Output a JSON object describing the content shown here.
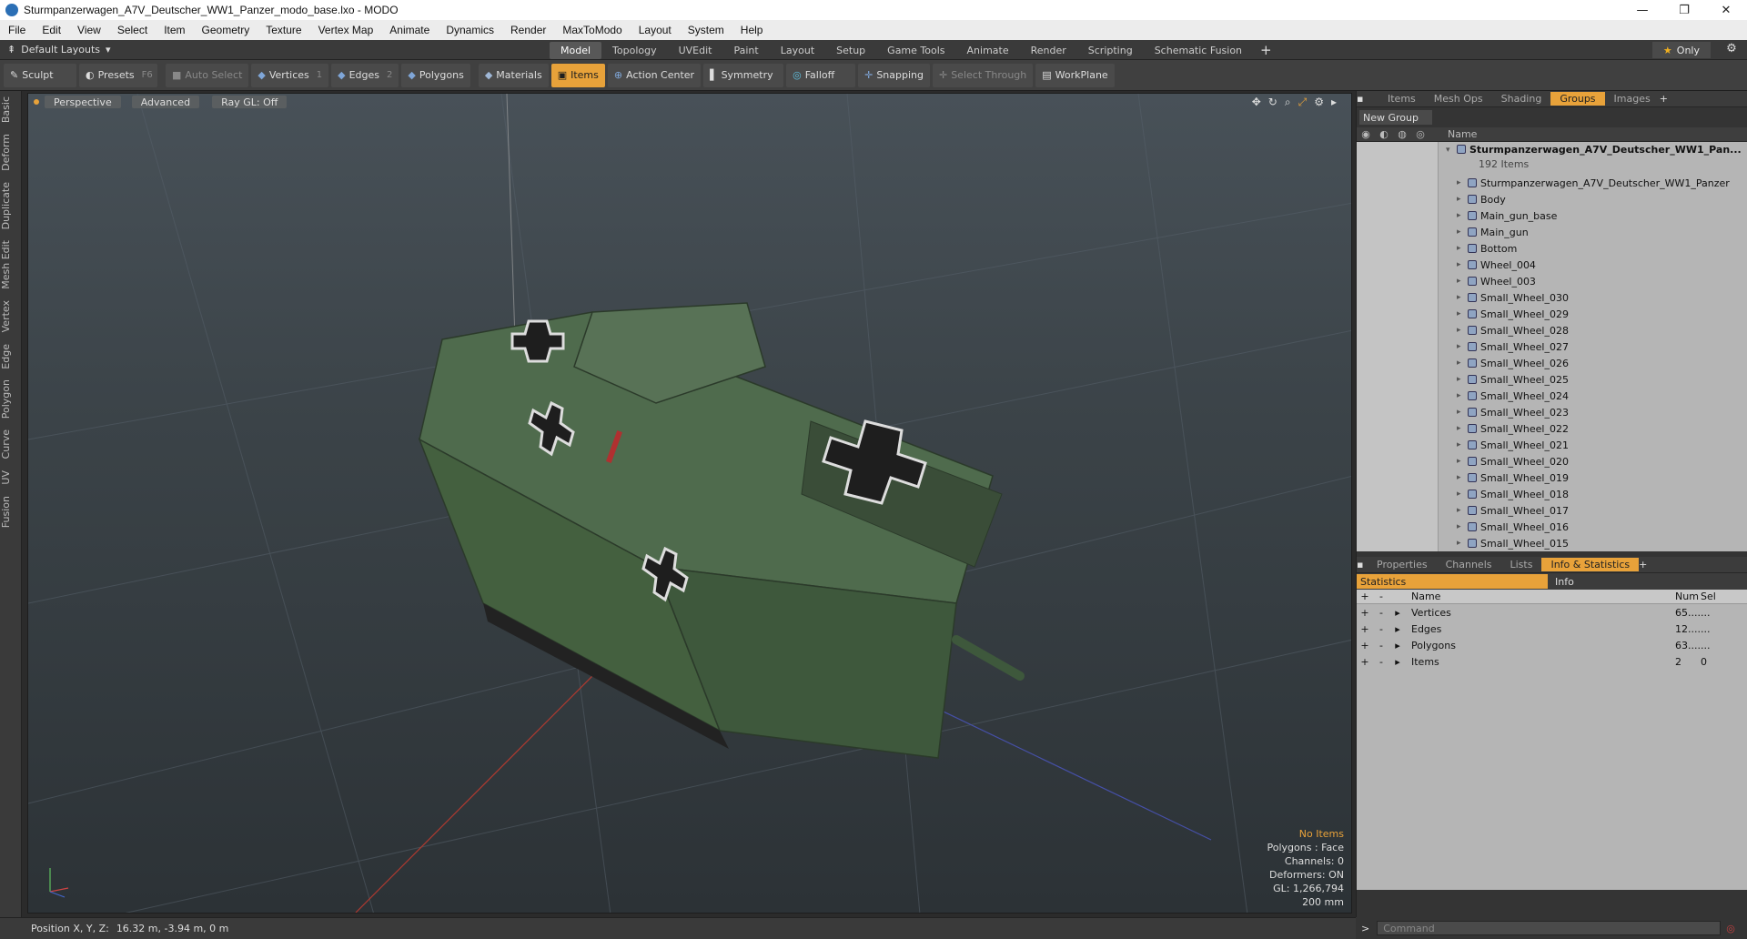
{
  "window": {
    "title": "Sturmpanzerwagen_A7V_Deutscher_WW1_Panzer_modo_base.lxo - MODO",
    "controls": [
      "—",
      "❐",
      "✕"
    ]
  },
  "menu": [
    "File",
    "Edit",
    "View",
    "Select",
    "Item",
    "Geometry",
    "Texture",
    "Vertex Map",
    "Animate",
    "Dynamics",
    "Render",
    "MaxToModo",
    "Layout",
    "System",
    "Help"
  ],
  "layoutbar": {
    "default_layouts": "Default Layouts",
    "tabs": [
      "Model",
      "Topology",
      "UVEdit",
      "Paint",
      "Layout",
      "Setup",
      "Game Tools",
      "Animate",
      "Render",
      "Scripting",
      "Schematic Fusion"
    ],
    "active_tab": "Model",
    "only_label": "Only"
  },
  "toolbar": {
    "sculpt": "Sculpt",
    "presets": "Presets",
    "presets_key": "F6",
    "auto_select": "Auto Select",
    "vertices": "Vertices",
    "vertices_num": "1",
    "edges": "Edges",
    "edges_num": "2",
    "polygons": "Polygons",
    "materials": "Materials",
    "items": "Items",
    "action_center": "Action Center",
    "symmetry": "Symmetry",
    "falloff": "Falloff",
    "snapping": "Snapping",
    "select_through": "Select Through",
    "workplane": "WorkPlane"
  },
  "left_tabs": [
    "Basic",
    "Deform",
    "Duplicate",
    "Mesh Edit",
    "Vertex",
    "Edge",
    "Polygon",
    "Curve",
    "UV",
    "Fusion"
  ],
  "viewport": {
    "view_mode": "Perspective",
    "shading": "Advanced",
    "raygl": "Ray GL: Off",
    "info": {
      "no_items": "No Items",
      "polygons": "Polygons : Face",
      "channels": "Channels: 0",
      "deformers": "Deformers: ON",
      "gl": "GL: 1,266,794",
      "scale": "200 mm"
    }
  },
  "status": {
    "position_label": "Position X, Y, Z:",
    "position_value": "16.32 m, -3.94 m, 0 m"
  },
  "panel_top": {
    "tabs": [
      "Items",
      "Mesh Ops",
      "Shading",
      "Groups",
      "Images"
    ],
    "active_tab": "Groups",
    "new_group": "New Group",
    "name_header": "Name",
    "root_name": "Sturmpanzerwagen_A7V_Deutscher_WW1_Pan...",
    "root_count": "192 Items",
    "items": [
      "Sturmpanzerwagen_A7V_Deutscher_WW1_Panzer",
      "Body",
      "Main_gun_base",
      "Main_gun",
      "Bottom",
      "Wheel_004",
      "Wheel_003",
      "Small_Wheel_030",
      "Small_Wheel_029",
      "Small_Wheel_028",
      "Small_Wheel_027",
      "Small_Wheel_026",
      "Small_Wheel_025",
      "Small_Wheel_024",
      "Small_Wheel_023",
      "Small_Wheel_022",
      "Small_Wheel_021",
      "Small_Wheel_020",
      "Small_Wheel_019",
      "Small_Wheel_018",
      "Small_Wheel_017",
      "Small_Wheel_016",
      "Small_Wheel_015"
    ]
  },
  "panel_bottom": {
    "tabs": [
      "Properties",
      "Channels",
      "Lists",
      "Info & Statistics"
    ],
    "active_tab": "Info & Statistics",
    "statistics_tab": "Statistics",
    "info_tab": "Info",
    "headers": {
      "name": "Name",
      "num": "Num",
      "sel": "Sel"
    },
    "rows": [
      {
        "name": "Vertices",
        "num": "65....",
        "sel": "..."
      },
      {
        "name": "Edges",
        "num": "12....",
        "sel": "..."
      },
      {
        "name": "Polygons",
        "num": "63....",
        "sel": "..."
      },
      {
        "name": "Items",
        "num": "2",
        "sel": "0"
      }
    ]
  },
  "command": {
    "prompt": ">",
    "placeholder": "Command"
  },
  "colors": {
    "accent": "#e8a23a",
    "tank_green": "#4f6b4d",
    "panel": "#343434"
  }
}
